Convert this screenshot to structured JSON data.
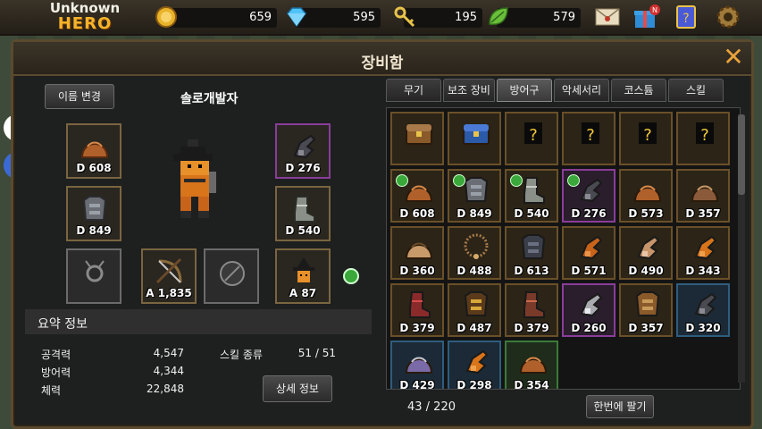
{
  "topbar": {
    "logo_line1": "Unknown",
    "logo_line2": "HERO",
    "resources": [
      {
        "name": "gold",
        "value": "659",
        "icon": "coin-icon",
        "color": "#e8b32a"
      },
      {
        "name": "gem",
        "value": "595",
        "icon": "diamond-icon",
        "color": "#4fc3f7"
      },
      {
        "name": "key",
        "value": "195",
        "icon": "key-icon",
        "color": "#e8c34a"
      },
      {
        "name": "leaf",
        "value": "579",
        "icon": "leaf-icon",
        "color": "#6abf3a"
      }
    ],
    "gift_badge": "N"
  },
  "window": {
    "title": "장비함",
    "close": "✕"
  },
  "character": {
    "rename_button": "이름 변경",
    "name": "솔로개발자",
    "slots": [
      {
        "label": "D 608",
        "icon": "leather-helmet-icon"
      },
      {
        "label": "D 849",
        "icon": "steel-armor-icon"
      },
      {
        "label": "",
        "icon": "empty-accessory-icon"
      },
      {
        "label": "A 1,835",
        "icon": "crossbow-icon"
      },
      {
        "label": "",
        "icon": "empty-shield-icon"
      },
      {
        "label": "D 276",
        "icon": "dark-gauntlet-icon"
      },
      {
        "label": "D 540",
        "icon": "plate-boots-icon"
      },
      {
        "label": "A 87",
        "icon": "witch-hat-icon"
      }
    ]
  },
  "summary": {
    "title": "요약 정보",
    "attack_label": "공격력",
    "attack_value": "4,547",
    "defense_label": "방어력",
    "defense_value": "4,344",
    "hp_label": "체력",
    "hp_value": "22,848",
    "skill_label": "스킬 종류",
    "skill_value": "51 / 51",
    "detail_button": "상세 정보"
  },
  "tabs": [
    {
      "label": "무기",
      "active": false
    },
    {
      "label": "보조 장비",
      "active": false
    },
    {
      "label": "방어구",
      "active": true
    },
    {
      "label": "악세서리",
      "active": false
    },
    {
      "label": "코스튬",
      "active": false
    },
    {
      "label": "스킬",
      "active": false
    }
  ],
  "inventory": {
    "items": [
      {
        "label": "",
        "icon": "wooden-chest-icon",
        "rarity": "normal",
        "equipped": false
      },
      {
        "label": "",
        "icon": "blue-chest-icon",
        "rarity": "normal",
        "equipped": false
      },
      {
        "label": "",
        "icon": "unknown-helmet-icon",
        "rarity": "normal",
        "equipped": false
      },
      {
        "label": "",
        "icon": "unknown-armor-icon",
        "rarity": "normal",
        "equipped": false
      },
      {
        "label": "",
        "icon": "unknown-gloves-icon",
        "rarity": "normal",
        "equipped": false
      },
      {
        "label": "",
        "icon": "unknown-boots-icon",
        "rarity": "normal",
        "equipped": false
      },
      {
        "label": "D 608",
        "icon": "leather-helmet-icon",
        "rarity": "normal",
        "equipped": true
      },
      {
        "label": "D 849",
        "icon": "steel-armor-icon",
        "rarity": "normal",
        "equipped": true
      },
      {
        "label": "D 540",
        "icon": "plate-boots-icon",
        "rarity": "normal",
        "equipped": true
      },
      {
        "label": "D 276",
        "icon": "dark-gauntlet-icon",
        "rarity": "purple",
        "equipped": true
      },
      {
        "label": "D 573",
        "icon": "leather-helmet-icon",
        "rarity": "normal",
        "equipped": false
      },
      {
        "label": "D 357",
        "icon": "brown-helmet-icon",
        "rarity": "normal",
        "equipped": false
      },
      {
        "label": "D 360",
        "icon": "horned-helmet-icon",
        "rarity": "normal",
        "equipped": false
      },
      {
        "label": "D 488",
        "icon": "bead-necklace-icon",
        "rarity": "normal",
        "equipped": false
      },
      {
        "label": "D 613",
        "icon": "dark-armor-icon",
        "rarity": "normal",
        "equipped": false
      },
      {
        "label": "D 571",
        "icon": "leather-glove-icon",
        "rarity": "normal",
        "equipped": false
      },
      {
        "label": "D 490",
        "icon": "pink-glove-icon",
        "rarity": "normal",
        "equipped": false
      },
      {
        "label": "D 343",
        "icon": "orange-glove-icon",
        "rarity": "normal",
        "equipped": false
      },
      {
        "label": "D 379",
        "icon": "red-boot-icon",
        "rarity": "normal",
        "equipped": false
      },
      {
        "label": "D 487",
        "icon": "gold-armor-icon",
        "rarity": "normal",
        "equipped": false
      },
      {
        "label": "D 379",
        "icon": "red-boots-icon",
        "rarity": "normal",
        "equipped": false
      },
      {
        "label": "D 260",
        "icon": "silver-gauntlet-icon",
        "rarity": "purple",
        "equipped": false
      },
      {
        "label": "D 357",
        "icon": "bronze-armor-icon",
        "rarity": "normal",
        "equipped": false
      },
      {
        "label": "D 320",
        "icon": "dark-gauntlet-icon",
        "rarity": "blue",
        "equipped": false
      },
      {
        "label": "D 429",
        "icon": "purple-helmet-icon",
        "rarity": "blue",
        "equipped": false
      },
      {
        "label": "D 298",
        "icon": "orange-glove-icon",
        "rarity": "blue",
        "equipped": false
      },
      {
        "label": "D 354",
        "icon": "leather-helmet-icon",
        "rarity": "green",
        "equipped": false
      }
    ],
    "count": "43 / 220",
    "sell_button": "한번에 팔기"
  }
}
